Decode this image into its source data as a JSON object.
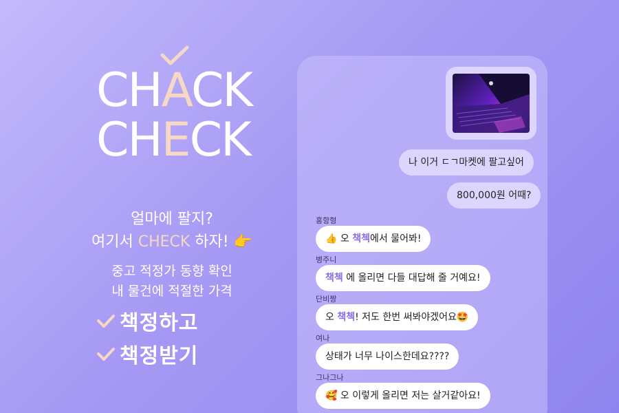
{
  "logo": {
    "line1_pre": "CH",
    "line1_hl": "A",
    "line1_post": "CK",
    "line2_pre": "CH",
    "line2_hl": "E",
    "line2_post": "CK"
  },
  "tagline": {
    "line1": "얼마에 팔지?",
    "line2_pre": "여기서 ",
    "line2_hl": "CHECK",
    "line2_post": " 하자! 👉"
  },
  "sub": {
    "line1": "중고 적정가 동향 확인",
    "line2": "내 물건에 적절한 가격"
  },
  "features": [
    "책정하고",
    "책정받기"
  ],
  "chat": {
    "my_messages": [
      "나 이거 ㄷㄱ마켓에 팔고싶어",
      "800,000원 어때?"
    ],
    "replies": [
      {
        "name": "홍항형",
        "pre": "👍 오 ",
        "accent": "책첵",
        "post": "에서 물어봐!"
      },
      {
        "name": "병주니",
        "pre": "",
        "accent": "책첵",
        "post": " 에 올리면 다들 대답해 줄 거예요!"
      },
      {
        "name": "단비짱",
        "pre": "오 ",
        "accent": "책첵",
        "post": "!  저도 한번 써봐야겠어요🤩"
      },
      {
        "name": "여나",
        "pre": "상태가 너무 나이스한데요????",
        "accent": "",
        "post": ""
      },
      {
        "name": "그나그나",
        "pre": "🥰 오 이렇게 올리면 저는 살거같아요!",
        "accent": "",
        "post": ""
      }
    ]
  },
  "colors": {
    "accent_peach": "#f7d8c4",
    "accent_purple": "#8a6de9",
    "bg_start": "#c3b9fb",
    "bg_end": "#8f84ee"
  }
}
